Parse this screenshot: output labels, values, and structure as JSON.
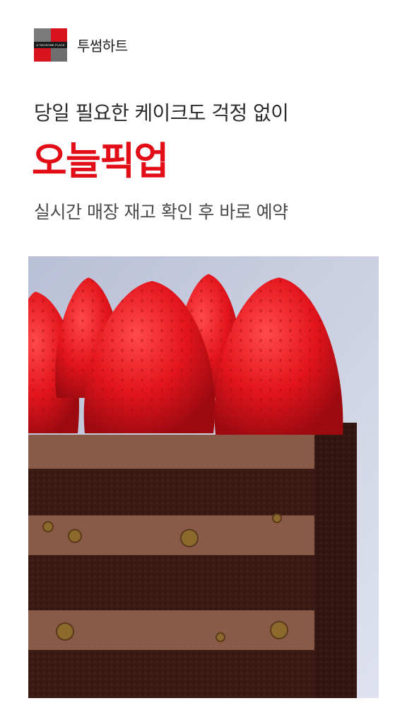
{
  "brand": {
    "logo_text": "A TWOSOME PLACE",
    "name": "투썸하트"
  },
  "headline": {
    "subtitle": "당일 필요한 케이크도 걱정 없이",
    "title": "오늘픽업",
    "title_color": "#e30d17"
  },
  "description": "실시간 매장 재고 확인 후 바로 예약",
  "product_image": {
    "subject": "strawberry chocolate layer cake"
  }
}
